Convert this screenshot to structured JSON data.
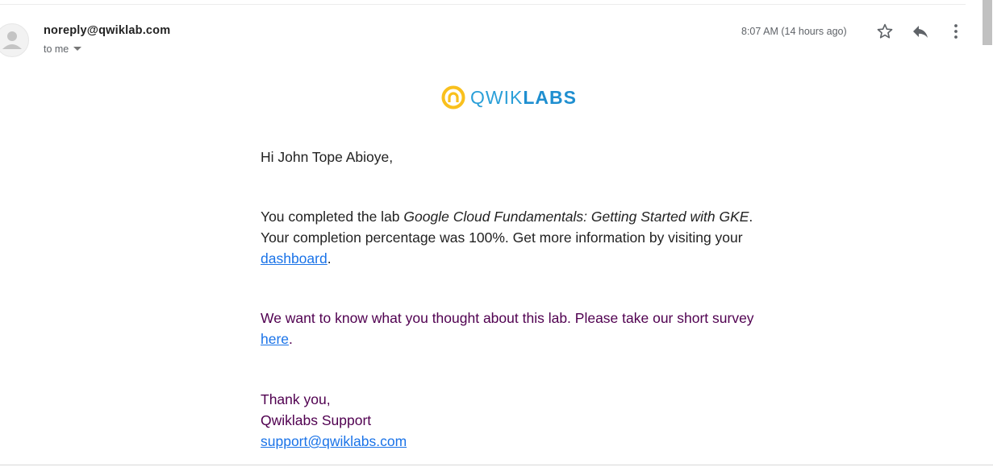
{
  "header": {
    "sender": "noreply@qwiklab.com",
    "recipient_label": "to me",
    "timestamp": "8:07 AM (14 hours ago)",
    "icons": {
      "avatar": "person-icon",
      "recipient_toggle": "caret-down-icon",
      "star": "star-icon",
      "reply": "reply-icon",
      "more": "more-vert-icon"
    }
  },
  "logo": {
    "text_light": "QWIK",
    "text_bold": "LABS",
    "icon": "qwiklabs-logo-icon",
    "colors": {
      "ring": "#f9c01d",
      "text": "#2a9fd8"
    }
  },
  "email": {
    "greeting": "Hi John Tope Abioye,",
    "completed_prefix": "You completed the lab ",
    "lab_name": "Google Cloud Fundamentals: Getting Started with GKE",
    "completed_mid": ". Your completion percentage was 100%. Get more information by visiting your ",
    "dashboard_link": "dashboard",
    "completed_end": ".",
    "survey_prefix": "We want to know what you thought about this lab. Please take our short survey ",
    "survey_link": "here",
    "survey_end": ".",
    "thanks": "Thank you,",
    "signature": "Qwiklabs Support",
    "support_email": "support@qwiklabs.com"
  },
  "colors": {
    "link": "#1a73e8",
    "quoted_text": "#500050",
    "body_text": "#222222"
  }
}
